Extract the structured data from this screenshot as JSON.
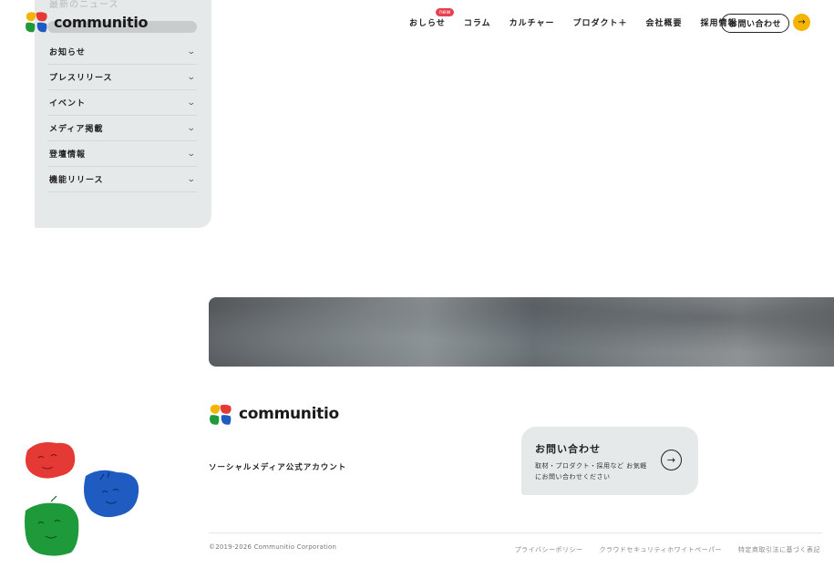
{
  "header": {
    "logo_text": "communitio",
    "nav": [
      {
        "label": "おしらせ",
        "badge": "new"
      },
      {
        "label": "コラム"
      },
      {
        "label": "カルチャー"
      },
      {
        "label": "プロダクト＋"
      },
      {
        "label": "会社概要"
      },
      {
        "label": "採用情報"
      }
    ],
    "contact_label": "お問い合わせ",
    "contact_arrow_icon": "arrow-right-icon",
    "accent_color": "#f5b400"
  },
  "sidebar": {
    "section_title": "最新のニュース",
    "items": [
      {
        "label": "お知らせ"
      },
      {
        "label": "プレスリリース"
      },
      {
        "label": "イベント"
      },
      {
        "label": "メディア掲載"
      },
      {
        "label": "登壇情報"
      },
      {
        "label": "機能リリース"
      }
    ],
    "chevron_icon": "chevron-down-icon"
  },
  "footer": {
    "logo_text": "communitio",
    "social_label": "ソーシャルメディア公式アカウント",
    "contact_card": {
      "title": "お問い合わせ",
      "description": "取材・プロダクト・採用など お気軽にお問い合わせください",
      "arrow_icon": "arrow-right-circle-icon"
    },
    "copyright": "©2019-2026 Communitio Corporation",
    "links": [
      {
        "label": "プライバシーポリシー"
      },
      {
        "label": "クラウドセキュリティホワイトペーパー"
      },
      {
        "label": "特定商取引法に基づく表記"
      }
    ]
  },
  "colors": {
    "panel_bg": "#e6e9e9",
    "badge": "#e8404e",
    "mascot_red": "#e53935",
    "mascot_blue": "#1f5cc2",
    "mascot_green": "#1f9a3a"
  }
}
